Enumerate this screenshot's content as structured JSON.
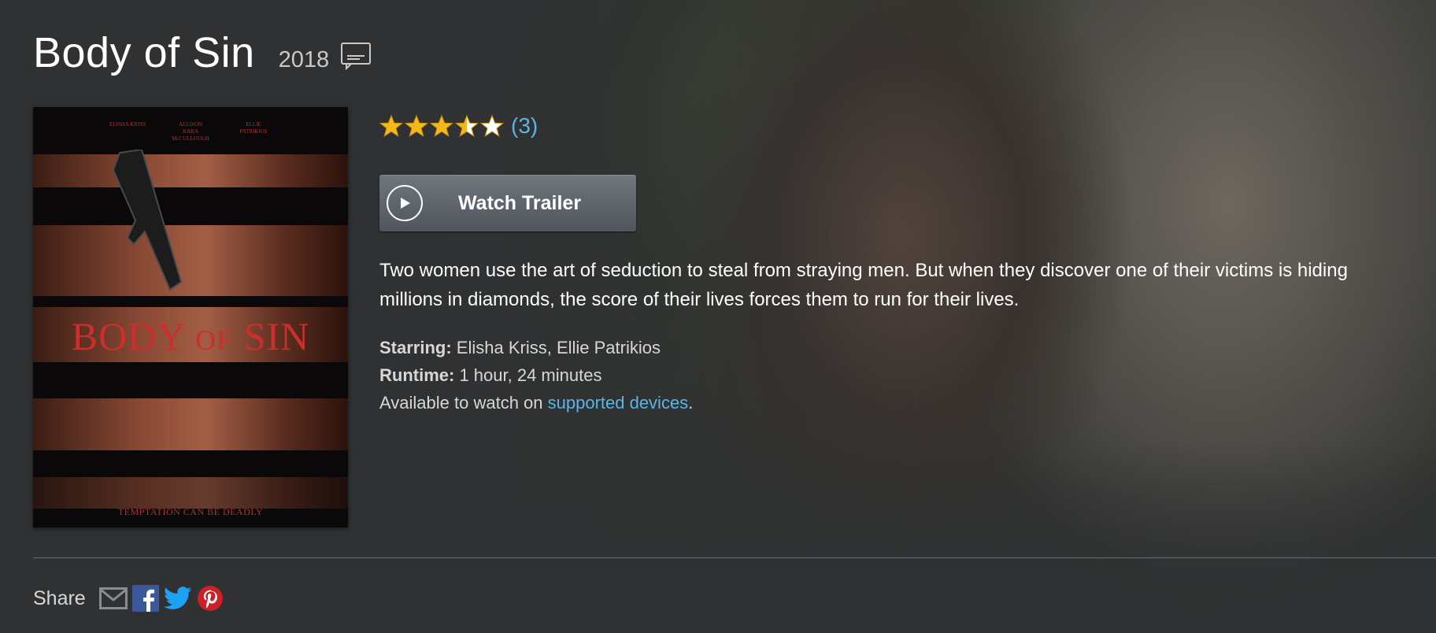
{
  "movie": {
    "title": "Body of Sin",
    "year": "2018"
  },
  "poster": {
    "credits": [
      "ELISHA KRISS",
      "ALLISON KARA McCULLOUGH",
      "ELLIE PATRIKIOS"
    ],
    "title_word_1": "BODY",
    "title_word_2": "OF",
    "title_word_3": "SIN",
    "tagline": "TEMPTATION CAN BE DEADLY"
  },
  "rating": {
    "stars": 3.5,
    "max_stars": 5,
    "count": "(3)",
    "star_color": "#f5b81b"
  },
  "trailer": {
    "label": "Watch Trailer"
  },
  "synopsis": "Two women use the art of seduction to steal from straying men. But when they discover one of their victims is hiding millions in diamonds, the score of their lives forces them to run for their lives.",
  "details": {
    "starring_label": "Starring:",
    "starring_value": " Elisha Kriss, Ellie Patrikios",
    "runtime_label": "Runtime:",
    "runtime_value": " 1 hour, 24 minutes",
    "available_text": "Available to watch on ",
    "available_link": "supported devices",
    "available_end": "."
  },
  "share": {
    "label": "Share",
    "icons": [
      "email-icon",
      "facebook-icon",
      "twitter-icon",
      "pinterest-icon"
    ]
  },
  "colors": {
    "background": "#2f3133",
    "link": "#5ab4e6",
    "facebook": "#3b5998",
    "twitter": "#1da1f2",
    "pinterest": "#cb2027"
  }
}
